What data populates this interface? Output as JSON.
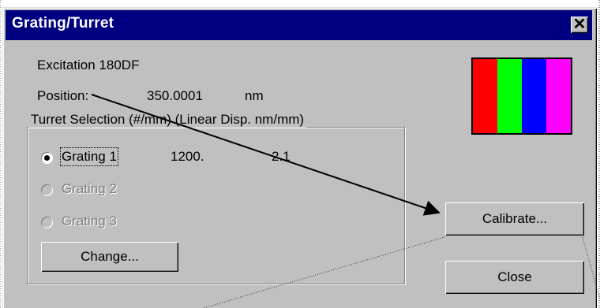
{
  "dialog": {
    "title": "Grating/Turret",
    "close_glyph": "✕"
  },
  "info": {
    "excitation": "Excitation 180DF",
    "position_label": "Position:",
    "position_value": "350.0001",
    "position_unit": "nm"
  },
  "turret": {
    "group_title": "Turret Selection  (#/mm)  (Linear Disp. nm/mm)",
    "gratings": [
      {
        "label": "Grating 1",
        "density": "1200.",
        "dispersion": "2.1",
        "selected": true,
        "enabled": true
      },
      {
        "label": "Grating 2",
        "enabled": false
      },
      {
        "label": "Grating 3",
        "enabled": false
      }
    ],
    "change_label": "Change..."
  },
  "buttons": {
    "calibrate_label": "Calibrate...",
    "close_label": "Close"
  },
  "color_bar": [
    "#ff0000",
    "#00ff00",
    "#0000ff",
    "#ff00ff"
  ]
}
